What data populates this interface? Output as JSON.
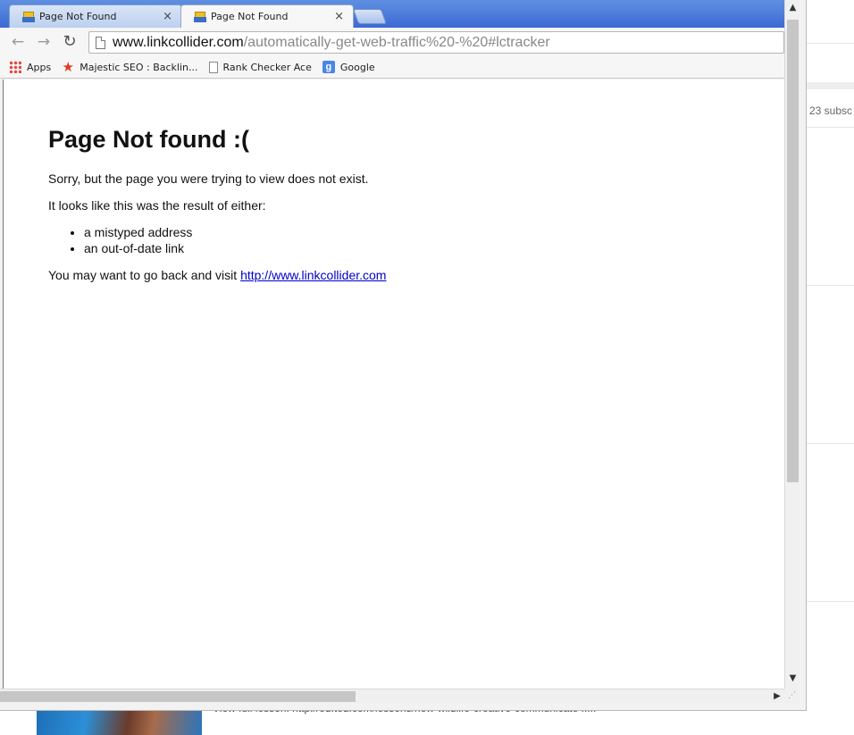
{
  "background": {
    "subscribers_text": "23 subsc",
    "bottom_text": "View full lesson: http://ed.ted.com/lessons/how-wildlife-creative-communicate ....."
  },
  "tabs": [
    {
      "title": "Page Not Found",
      "active": false,
      "close_icon": "×"
    },
    {
      "title": "Page Not Found",
      "active": true,
      "close_icon": "×"
    }
  ],
  "toolbar": {
    "back_icon": "←",
    "forward_icon": "→",
    "reload_icon": "↻",
    "url_host": "www.linkcollider.com",
    "url_path": "/automatically-get-web-traffic%20-%20#lctracker"
  },
  "bookmarks": [
    {
      "label": "Apps",
      "icon": "apps-grid-icon"
    },
    {
      "label": "Majestic SEO : Backlin...",
      "icon": "star-icon"
    },
    {
      "label": "Rank Checker Ace",
      "icon": "page-icon"
    },
    {
      "label": "Google",
      "icon": "google-icon"
    }
  ],
  "content": {
    "title": "Page Not found :(",
    "sorry": "Sorry, but the page you were trying to view does not exist.",
    "result_intro": "It looks like this was the result of either:",
    "reasons": [
      "a mistyped address",
      "an out-of-date link"
    ],
    "visit_prefix": "You may want to go back and visit ",
    "visit_link": "http://www.linkcollider.com"
  },
  "scrollbars": {
    "up_arrow": "▲",
    "down_arrow": "▼",
    "right_arrow": "▶",
    "grip": "⋰"
  }
}
